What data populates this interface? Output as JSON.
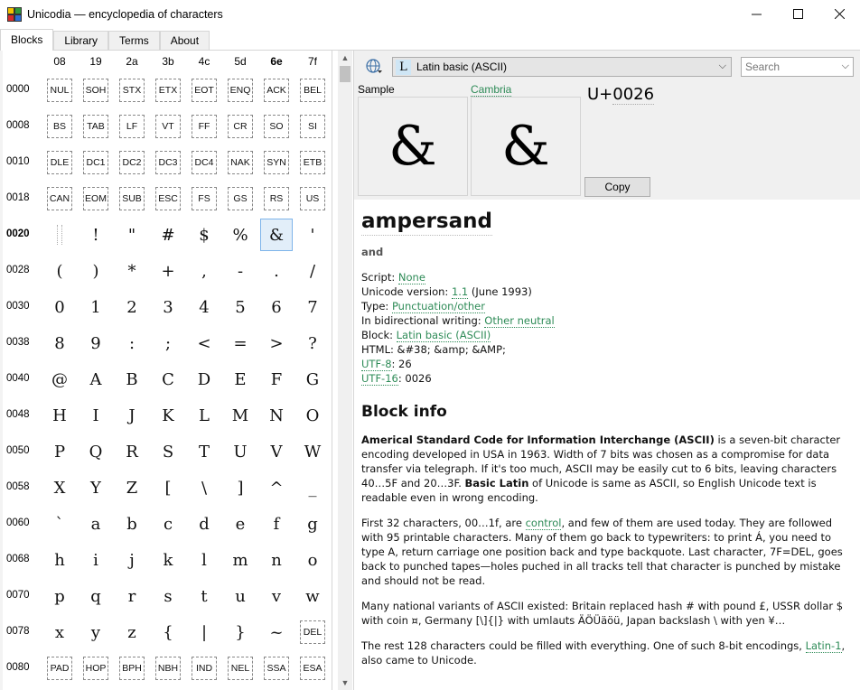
{
  "window": {
    "title": "Unicodia — encyclopedia of characters",
    "buttons": [
      "—",
      "☐",
      "✕"
    ]
  },
  "tabs": [
    {
      "label": "Blocks",
      "active": true
    },
    {
      "label": "Library",
      "active": false
    },
    {
      "label": "Terms",
      "active": false
    },
    {
      "label": "About",
      "active": false
    }
  ],
  "grid": {
    "columns": [
      "08",
      "19",
      "2a",
      "3b",
      "4c",
      "5d",
      "6e",
      "7f"
    ],
    "bold_column": 6,
    "rows": [
      {
        "label": "0000",
        "type": "ctrl",
        "cells": [
          "NUL",
          "SOH",
          "STX",
          "ETX",
          "EOT",
          "ENQ",
          "ACK",
          "BEL"
        ]
      },
      {
        "label": "0008",
        "type": "ctrl",
        "cells": [
          "BS",
          "TAB",
          "LF",
          "VT",
          "FF",
          "CR",
          "SO",
          "SI"
        ]
      },
      {
        "label": "0010",
        "type": "ctrl",
        "cells": [
          "DLE",
          "DC1",
          "DC2",
          "DC3",
          "DC4",
          "NAK",
          "SYN",
          "ETB"
        ]
      },
      {
        "label": "0018",
        "type": "ctrl",
        "cells": [
          "CAN",
          "EOM",
          "SUB",
          "ESC",
          "FS",
          "GS",
          "RS",
          "US"
        ]
      },
      {
        "label": "0020",
        "type": "char",
        "bold": true,
        "cells": [
          "",
          "!",
          "\"",
          "#",
          "$",
          "%",
          "&",
          "'"
        ]
      },
      {
        "label": "0028",
        "type": "char",
        "cells": [
          "(",
          ")",
          "*",
          "+",
          ",",
          "-",
          ".",
          "/"
        ]
      },
      {
        "label": "0030",
        "type": "char",
        "cells": [
          "0",
          "1",
          "2",
          "3",
          "4",
          "5",
          "6",
          "7"
        ]
      },
      {
        "label": "0038",
        "type": "char",
        "cells": [
          "8",
          "9",
          ":",
          ";",
          "<",
          "=",
          ">",
          "?"
        ]
      },
      {
        "label": "0040",
        "type": "char",
        "cells": [
          "@",
          "A",
          "B",
          "C",
          "D",
          "E",
          "F",
          "G"
        ]
      },
      {
        "label": "0048",
        "type": "char",
        "cells": [
          "H",
          "I",
          "J",
          "K",
          "L",
          "M",
          "N",
          "O"
        ]
      },
      {
        "label": "0050",
        "type": "char",
        "cells": [
          "P",
          "Q",
          "R",
          "S",
          "T",
          "U",
          "V",
          "W"
        ]
      },
      {
        "label": "0058",
        "type": "char",
        "cells": [
          "X",
          "Y",
          "Z",
          "[",
          "\\",
          "]",
          "^",
          "_"
        ]
      },
      {
        "label": "0060",
        "type": "char",
        "cells": [
          "`",
          "a",
          "b",
          "c",
          "d",
          "e",
          "f",
          "g"
        ]
      },
      {
        "label": "0068",
        "type": "char",
        "cells": [
          "h",
          "i",
          "j",
          "k",
          "l",
          "m",
          "n",
          "o"
        ]
      },
      {
        "label": "0070",
        "type": "char",
        "cells": [
          "p",
          "q",
          "r",
          "s",
          "t",
          "u",
          "v",
          "w"
        ]
      },
      {
        "label": "0078",
        "type": "mixed",
        "cells": [
          "x",
          "y",
          "z",
          "{",
          "|",
          "}",
          "~",
          "DEL"
        ],
        "ctrl_cells": [
          7
        ]
      },
      {
        "label": "0080",
        "type": "ctrl",
        "cells": [
          "PAD",
          "HOP",
          "BPH",
          "NBH",
          "IND",
          "NEL",
          "SSA",
          "ESA"
        ]
      }
    ],
    "selected": {
      "row": 4,
      "col": 6
    }
  },
  "toolbar": {
    "block_badge": "L",
    "block_value": "Latin basic (ASCII)",
    "search_placeholder": "Search"
  },
  "preview": {
    "sample_label": "Sample",
    "font_label": "Cambria",
    "sample_glyph": "&",
    "font_glyph": "&",
    "codepoint_prefix": "U+",
    "codepoint_hex": "0026",
    "copy_label": "Copy"
  },
  "char_info": {
    "name": "ampersand",
    "alias": "and",
    "script_label": "Script: ",
    "script_value": "None",
    "version_label": "Unicode version: ",
    "version_value": "1.1",
    "version_suffix": " (June 1993)",
    "type_label": "Type: ",
    "type_value": "Punctuation/other",
    "bidi_label": "In bidirectional writing: ",
    "bidi_value": "Other neutral",
    "block_label": "Block: ",
    "block_value": "Latin basic (ASCII)",
    "html_label": "HTML: ",
    "html_value": "&#38; &amp; &AMP;",
    "utf8_label": "UTF-8",
    "utf8_value": ": 26",
    "utf16_label": "UTF-16",
    "utf16_value": ": 0026"
  },
  "block_info": {
    "heading": "Block info",
    "p1_bold": "Americal Standard Code for Information Interchange (ASCII)",
    "p1_text": " is a seven-bit character encoding developed in USA in 1963. Width of 7 bits was chosen as a compromise for data transfer via telegraph. If it's too much, ASCII may be easily cut to 6 bits, leaving characters 40…5F and 20…3F. ",
    "p1_bold2": "Basic Latin",
    "p1_text2": " of Unicode is same as ASCII, so English Unicode text is readable even in wrong encoding.",
    "p2_text1": "First 32 characters, 00…1f, are ",
    "p2_link": "control",
    "p2_text2": ", and few of them are used today. They are followed with 95 printable characters. Many of them go back to typewriters: to print Á, you need to type A, return carriage one position back and type backquote. Last character, 7F=DEL, goes back to punched tapes—holes puched in all tracks tell that character is punched by mistake and should not be read.",
    "p3_text": "Many national variants of ASCII existed: Britain replaced hash # with pound £, USSR dollar $ with coin ¤, Germany [\\]{|} with umlauts ÄÖÜäöü, Japan backslash \\ with yen ¥…",
    "p4_text1": "The rest 128 characters could be filled with everything. One of such 8-bit encodings, ",
    "p4_link": "Latin-1",
    "p4_text2": ", also came to Unicode."
  }
}
